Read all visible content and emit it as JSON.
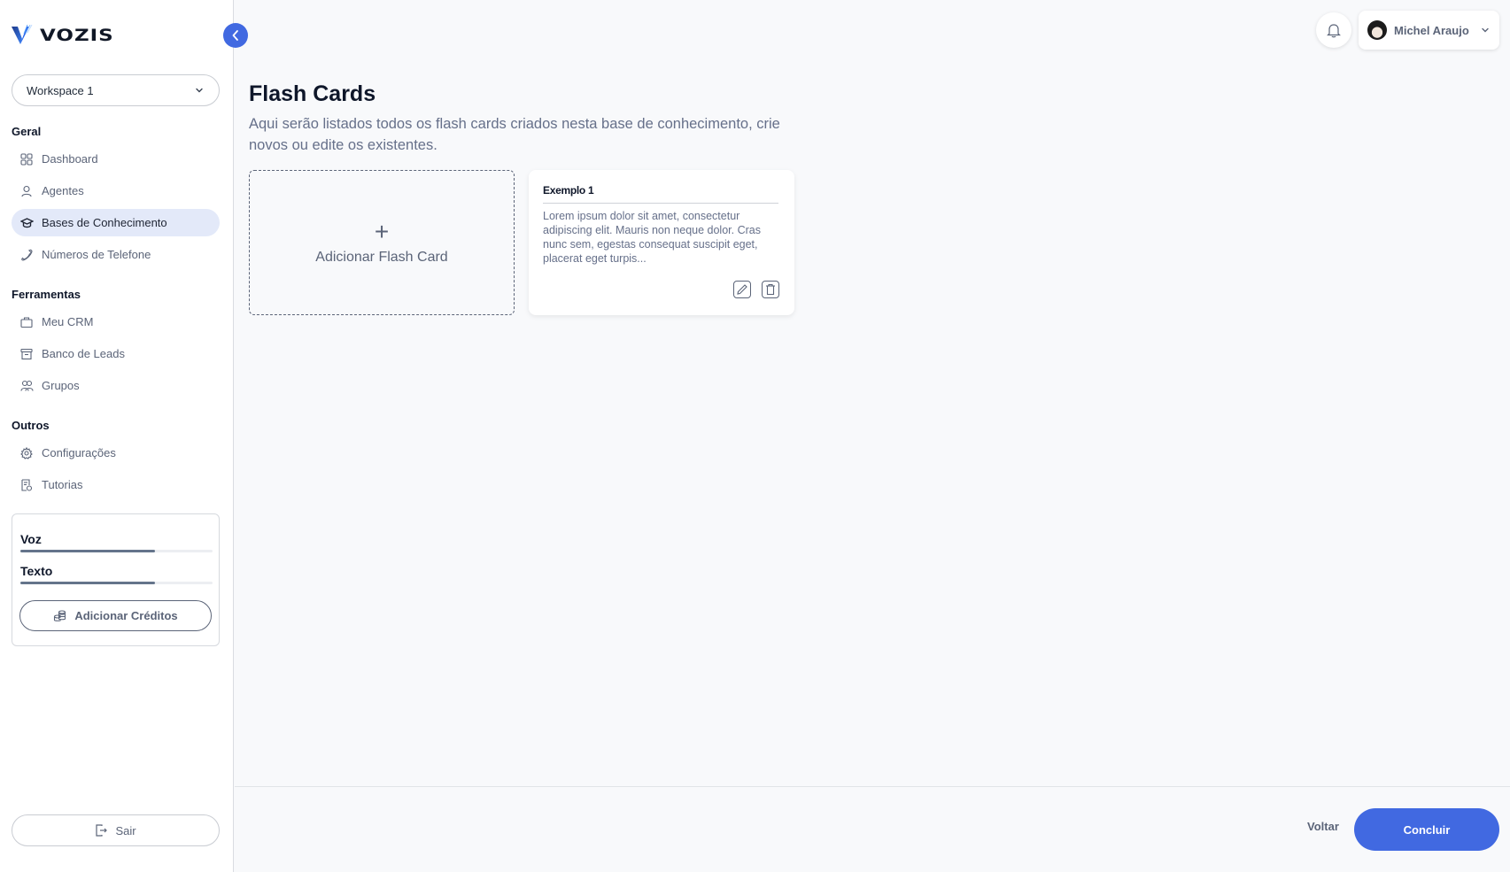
{
  "brand": {
    "name": "VOZIS",
    "accent": "#4169e1"
  },
  "workspace": {
    "selected": "Workspace 1"
  },
  "sidebar": {
    "sections": [
      {
        "label": "Geral",
        "items": [
          {
            "label": "Dashboard",
            "icon": "grid-icon"
          },
          {
            "label": "Agentes",
            "icon": "user-icon"
          },
          {
            "label": "Bases de Conhecimento",
            "icon": "graduation-cap-icon",
            "active": true
          },
          {
            "label": "Números de Telefone",
            "icon": "phone-icon"
          }
        ]
      },
      {
        "label": "Ferramentas",
        "items": [
          {
            "label": "Meu CRM",
            "icon": "briefcase-icon"
          },
          {
            "label": "Banco de Leads",
            "icon": "archive-icon"
          },
          {
            "label": "Grupos",
            "icon": "users-icon"
          }
        ]
      },
      {
        "label": "Outros",
        "items": [
          {
            "label": "Configurações",
            "icon": "gear-icon"
          },
          {
            "label": "Tutorias",
            "icon": "document-icon"
          }
        ]
      }
    ],
    "credits": {
      "voice": {
        "label": "Voz",
        "progress": 0.7
      },
      "text": {
        "label": "Texto",
        "progress": 0.7
      },
      "add_label": "Adicionar Créditos"
    },
    "logout_label": "Sair"
  },
  "header": {
    "user_name": "Michel Araujo"
  },
  "main": {
    "title": "Flash Cards",
    "description": "Aqui serão listados todos os flash cards criados nesta base de conhecimento, crie novos ou edite os existentes.",
    "add_card_label": "Adicionar Flash Card",
    "cards": [
      {
        "title": "Exemplo 1",
        "body": "Lorem ipsum dolor sit amet, consectetur adipiscing elit. Mauris non neque dolor. Cras nunc sem, egestas consequat suscipit eget, placerat eget turpis..."
      }
    ]
  },
  "footer": {
    "back_label": "Voltar",
    "done_label": "Concluir"
  }
}
